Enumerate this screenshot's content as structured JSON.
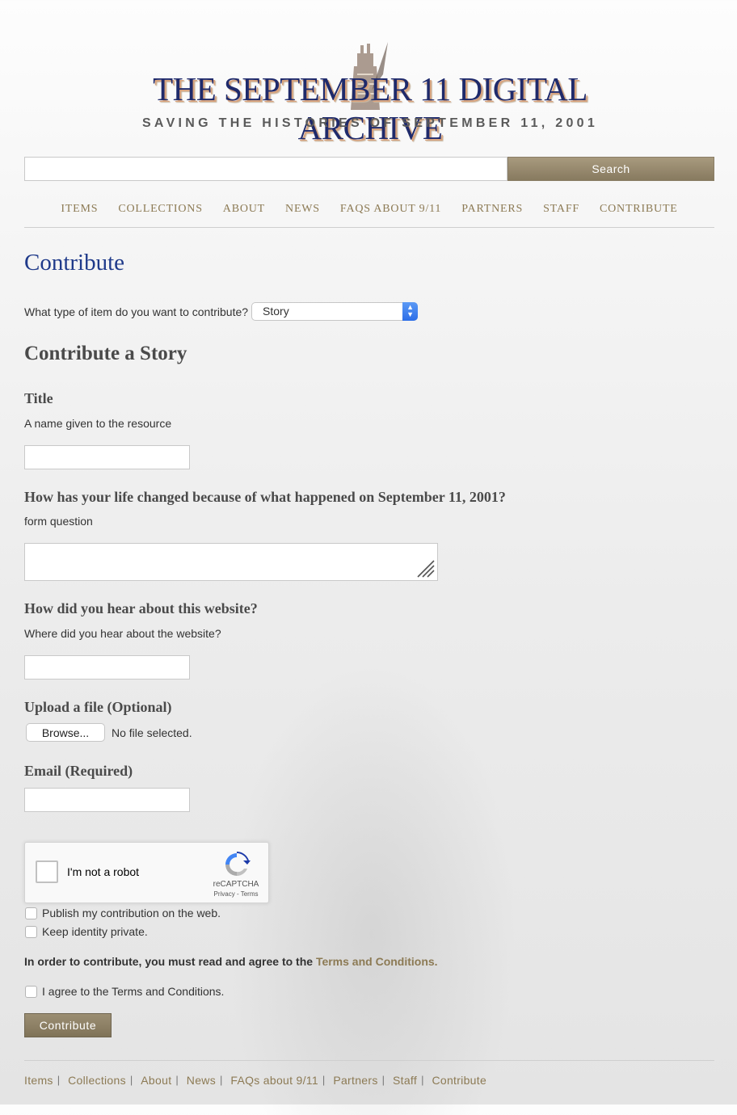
{
  "header": {
    "site_title": "THE SEPTEMBER 11 DIGITAL ARCHIVE",
    "tagline": "SAVING THE HISTORIES OF SEPTEMBER 11, 2001",
    "search_button": "Search",
    "search_value": ""
  },
  "nav": {
    "items": [
      "ITEMS",
      "COLLECTIONS",
      "ABOUT",
      "NEWS",
      "FAQS ABOUT 9/11",
      "PARTNERS",
      "STAFF",
      "CONTRIBUTE"
    ]
  },
  "main": {
    "page_title": "Contribute",
    "type_question": "What type of item do you want to contribute?",
    "type_selected": "Story",
    "section_title": "Contribute a Story",
    "fields": {
      "title": {
        "label": "Title",
        "description": "A name given to the resource",
        "value": ""
      },
      "question": {
        "label": "How has your life changed because of what happened on September 11, 2001?",
        "description": "form question",
        "value": ""
      },
      "hear": {
        "label": "How did you hear about this website?",
        "description": "Where did you hear about the website?",
        "value": ""
      },
      "upload": {
        "label": "Upload a file (Optional)",
        "button": "Browse...",
        "status": "No file selected."
      },
      "email": {
        "label": "Email (Required)",
        "value": ""
      }
    },
    "recaptcha": {
      "label": "I'm not a robot",
      "brand": "reCAPTCHA",
      "links": "Privacy - Terms"
    },
    "options": {
      "publish": "Publish my contribution on the web.",
      "private": "Keep identity private."
    },
    "terms": {
      "note": "In order to contribute, you must read and agree to the ",
      "link": "Terms and Conditions.",
      "agree": "I agree to the Terms and Conditions."
    },
    "submit": "Contribute"
  },
  "footer": {
    "items": [
      "Items",
      "Collections",
      "About",
      "News",
      "FAQs about 9/11",
      "Partners",
      "Staff",
      "Contribute"
    ],
    "separator": "|"
  },
  "colors": {
    "accent_gold": "#8c7a54",
    "title_blue": "#1f3a8a",
    "select_blue": "#2c6ee8"
  }
}
